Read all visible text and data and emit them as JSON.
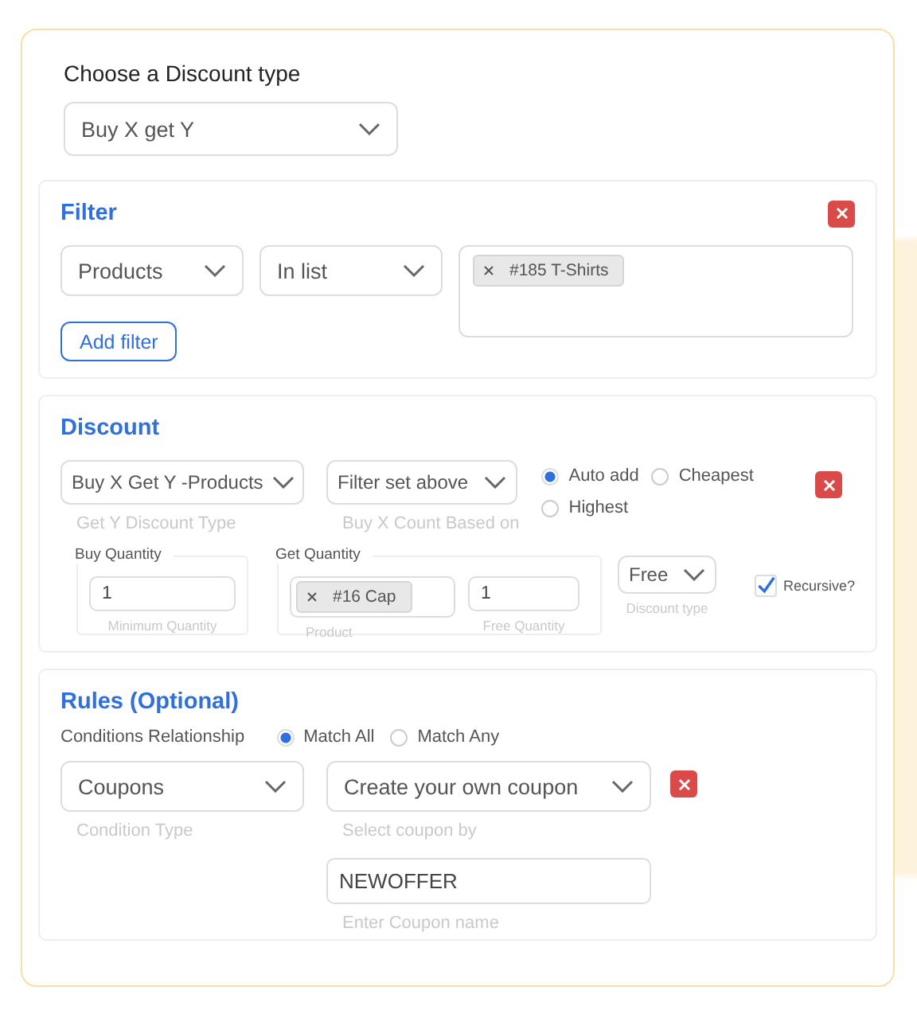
{
  "discount_type": {
    "label": "Choose a Discount type",
    "value": "Buy X get Y"
  },
  "filter": {
    "title": "Filter",
    "field": "Products",
    "operator": "In list",
    "tags": [
      "#185 T-Shirts"
    ],
    "add_button": "Add filter"
  },
  "discount": {
    "title": "Discount",
    "get_type": {
      "value": "Buy X Get Y -Products",
      "caption": "Get Y Discount Type"
    },
    "count_based": {
      "value": "Filter set above",
      "caption": "Buy X Count Based on"
    },
    "modes": [
      {
        "label": "Auto add",
        "selected": true
      },
      {
        "label": "Cheapest",
        "selected": false
      },
      {
        "label": "Highest",
        "selected": false
      }
    ],
    "buy": {
      "legend": "Buy Quantity",
      "value": "1",
      "caption": "Minimum Quantity"
    },
    "get": {
      "legend": "Get Quantity",
      "tags": [
        "#16 Cap"
      ],
      "product_caption": "Product",
      "value": "1",
      "quantity_caption": "Free Quantity"
    },
    "discount_type": {
      "value": "Free",
      "caption": "Discount type"
    },
    "recursive": {
      "label": "Recursive?",
      "checked": true
    }
  },
  "rules": {
    "title": "Rules (Optional)",
    "relationship_label": "Conditions Relationship",
    "relationship": [
      {
        "label": "Match All",
        "selected": true
      },
      {
        "label": "Match Any",
        "selected": false
      }
    ],
    "condition": {
      "value": "Coupons",
      "caption": "Condition Type"
    },
    "coupon_by": {
      "value": "Create your own coupon",
      "caption": "Select coupon by"
    },
    "coupon_name": {
      "value": "NEWOFFER",
      "caption": "Enter Coupon name"
    }
  }
}
